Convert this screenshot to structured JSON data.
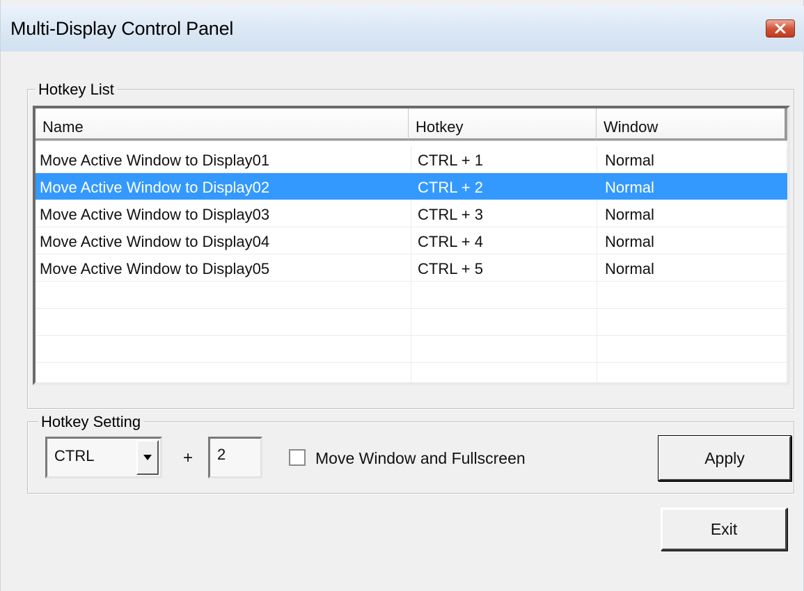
{
  "window": {
    "title": "Multi-Display Control Panel",
    "close_icon": "close-x-icon"
  },
  "hotkey_list": {
    "legend": "Hotkey List",
    "columns": [
      "Name",
      "Hotkey",
      "Window"
    ],
    "rows": [
      {
        "name": "Move Active Window to Display01",
        "hotkey": "CTRL + 1",
        "window": "Normal",
        "selected": false
      },
      {
        "name": "Move Active Window to Display02",
        "hotkey": "CTRL + 2",
        "window": "Normal",
        "selected": true
      },
      {
        "name": "Move Active Window to Display03",
        "hotkey": "CTRL + 3",
        "window": "Normal",
        "selected": false
      },
      {
        "name": "Move Active Window to Display04",
        "hotkey": "CTRL + 4",
        "window": "Normal",
        "selected": false
      },
      {
        "name": "Move Active Window to Display05",
        "hotkey": "CTRL + 5",
        "window": "Normal",
        "selected": false
      }
    ]
  },
  "hotkey_setting": {
    "legend": "Hotkey Setting",
    "modifier_value": "CTRL",
    "plus": "+",
    "key_value": "2",
    "fullscreen_label": "Move Window and Fullscreen",
    "fullscreen_checked": false,
    "apply_label": "Apply"
  },
  "footer": {
    "exit_label": "Exit"
  },
  "colors": {
    "selection": "#3399ff",
    "window_bg": "#f0f0f0",
    "close_button": "#c94a2e"
  }
}
